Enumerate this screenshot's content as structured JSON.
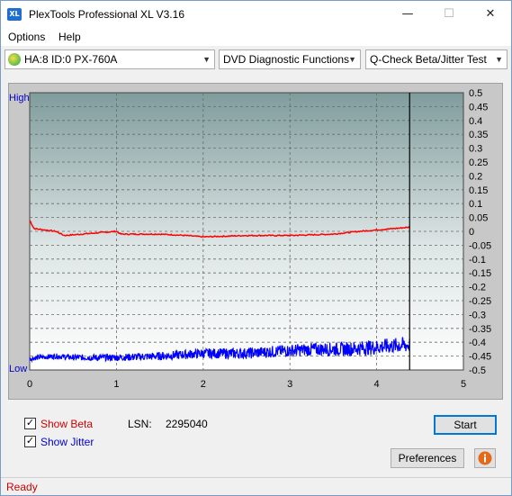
{
  "window": {
    "title": "PlexTools Professional XL V3.16",
    "icon_text": "XL"
  },
  "window_buttons": {
    "minimize": "—",
    "maximize": "☐",
    "close": "✕"
  },
  "menu": {
    "options": "Options",
    "help": "Help"
  },
  "toolbar": {
    "drive": "HA:8 ID:0  PX-760A",
    "function": "DVD Diagnostic Functions",
    "test": "Q-Check Beta/Jitter Test"
  },
  "chart_data": {
    "type": "line",
    "xlim": [
      0,
      5
    ],
    "x_ticks": [
      "0",
      "1",
      "2",
      "3",
      "4",
      "5"
    ],
    "ylim": [
      -0.5,
      0.5
    ],
    "y_ticks": [
      "0.5",
      "0.45",
      "0.4",
      "0.35",
      "0.3",
      "0.25",
      "0.2",
      "0.15",
      "0.1",
      "0.05",
      "0",
      "-0.05",
      "-0.1",
      "-0.15",
      "-0.2",
      "-0.25",
      "-0.3",
      "-0.35",
      "-0.4",
      "-0.45",
      "-0.5"
    ],
    "left_labels": {
      "high": "High",
      "low": "Low"
    },
    "end_marker_x": 4.38,
    "grid": true,
    "series": [
      {
        "name": "Beta",
        "color": "#ff0000",
        "x": [
          0.0,
          0.05,
          0.3,
          0.4,
          0.6,
          1.0,
          1.05,
          1.5,
          1.8,
          2.0,
          2.5,
          3.0,
          3.5,
          3.8,
          4.0,
          4.2,
          4.38
        ],
        "y": [
          0.04,
          0.01,
          0.0,
          -0.015,
          -0.01,
          0.0,
          -0.01,
          -0.01,
          -0.015,
          -0.02,
          -0.015,
          -0.015,
          -0.01,
          0.0,
          0.005,
          0.01,
          0.015
        ]
      },
      {
        "name": "Jitter",
        "color": "#0000ff",
        "x": [
          0.0,
          0.1,
          0.3,
          0.5,
          1.0,
          1.5,
          2.0,
          2.2,
          2.5,
          3.0,
          3.3,
          3.6,
          3.9,
          4.1,
          4.3,
          4.38
        ],
        "y": [
          -0.46,
          -0.455,
          -0.45,
          -0.455,
          -0.455,
          -0.45,
          -0.44,
          -0.44,
          -0.44,
          -0.43,
          -0.425,
          -0.425,
          -0.42,
          -0.415,
          -0.41,
          -0.41
        ]
      }
    ]
  },
  "controls": {
    "show_beta_label": "Show Beta",
    "show_jitter_label": "Show Jitter",
    "show_beta_checked": true,
    "show_jitter_checked": true,
    "lsn_label": "LSN:",
    "lsn_value": "2295040",
    "start_button": "Start",
    "preferences_button": "Preferences",
    "info_icon": "info-icon"
  },
  "colors": {
    "beta": "#cc0000",
    "jitter": "#0000cc",
    "accent": "#0078d7"
  },
  "status": {
    "text": "Ready"
  }
}
